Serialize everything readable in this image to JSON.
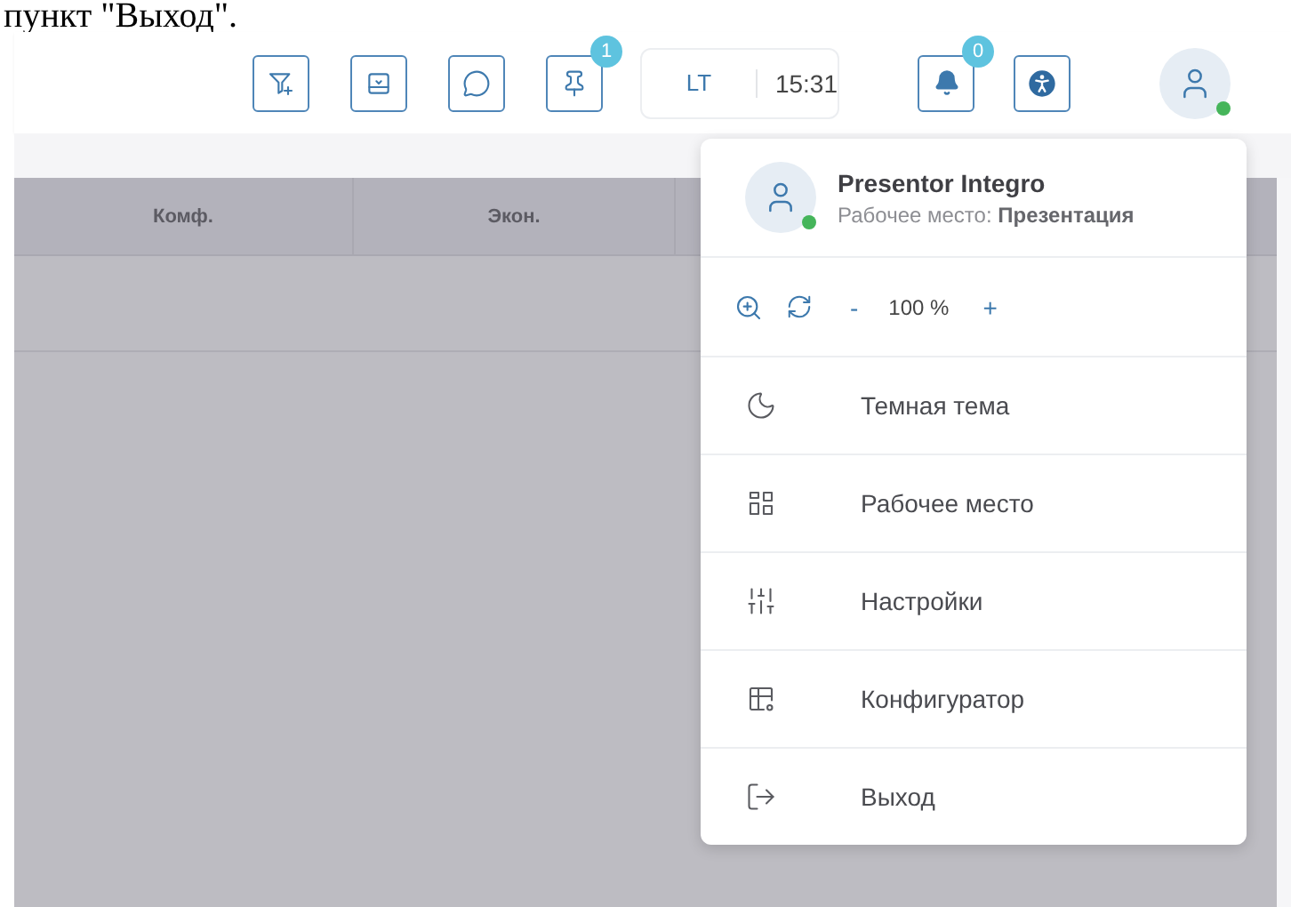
{
  "caption": "пункт \"Выход\".",
  "toolbar": {
    "buttons": [
      {
        "kind": "filter"
      },
      {
        "kind": "tray"
      },
      {
        "kind": "chat"
      },
      {
        "kind": "pin",
        "badge": "1"
      }
    ],
    "clock": {
      "zone": "LT",
      "time": "15:31"
    },
    "alerts": [
      {
        "kind": "bell",
        "badge": "0"
      },
      {
        "kind": "accessibility"
      }
    ],
    "user": {
      "online": true
    }
  },
  "table": {
    "columns": [
      "Комф.",
      "Экон."
    ]
  },
  "menu": {
    "user": {
      "name": "Presentor Integro",
      "workplace": "Рабочее место: **Презентация**",
      "online": true
    },
    "zoom": {
      "minus": "-",
      "value": "100 %",
      "plus": "+"
    },
    "items": [
      {
        "kind": "theme",
        "label": "Темная тема"
      },
      {
        "kind": "workplace",
        "label": "Рабочее место"
      },
      {
        "kind": "settings",
        "label": "Настройки"
      },
      {
        "kind": "configurator",
        "label": "Конфигуратор"
      },
      {
        "kind": "logout",
        "label": "Выход"
      }
    ]
  }
}
